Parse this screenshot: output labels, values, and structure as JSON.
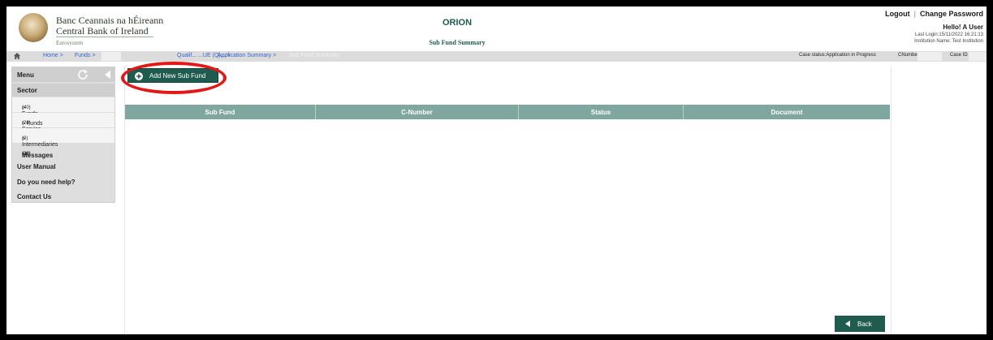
{
  "header": {
    "bank_name_irish": "Banc Ceannais na hÉireann",
    "bank_name_english": "Central Bank of Ireland",
    "eurosystem": "Eurosystem",
    "app_title": "ORION",
    "page_subtitle": "Sub Fund Summary",
    "logout": "Logout",
    "separator": "|",
    "change_password": "Change Password",
    "greeting": "Hello! A User",
    "last_login": "Last Login:15/11/2022 16:21:13",
    "institution": "Institution Name: Test Institution"
  },
  "breadcrumb": {
    "home": "Home >",
    "funds": "Funds >",
    "qualifying": "Qualif... ...UE (Q)... >",
    "application_summary": "Application Summary >",
    "current": "Sub Fund Summary",
    "case_status": "Case status:Application in Progress",
    "cnumber_label": "CNumbe",
    "case_id_label": "Case ID"
  },
  "sidebar": {
    "menu_label": "Menu",
    "sector_label": "Sector",
    "sub_items": [
      {
        "label": "> Funds",
        "count": "(40)"
      },
      {
        "label": "> Funds Service Providers",
        "count": "(26)"
      },
      {
        "label": "> Intermediaries",
        "count": "(0)"
      }
    ],
    "messages_label": "Messages",
    "messages_count": "(28)",
    "user_manual": "User Manual",
    "help": "Do you need help?",
    "contact": "Contact Us"
  },
  "main": {
    "add_button_label": "Add New Sub Fund",
    "columns": [
      "Sub Fund",
      "C-Number",
      "Status",
      "Document"
    ],
    "back_button_label": "Back"
  },
  "colors": {
    "brand_green": "#1f5c4f",
    "grid_header": "#7fa79f",
    "highlight": "#e51616"
  }
}
